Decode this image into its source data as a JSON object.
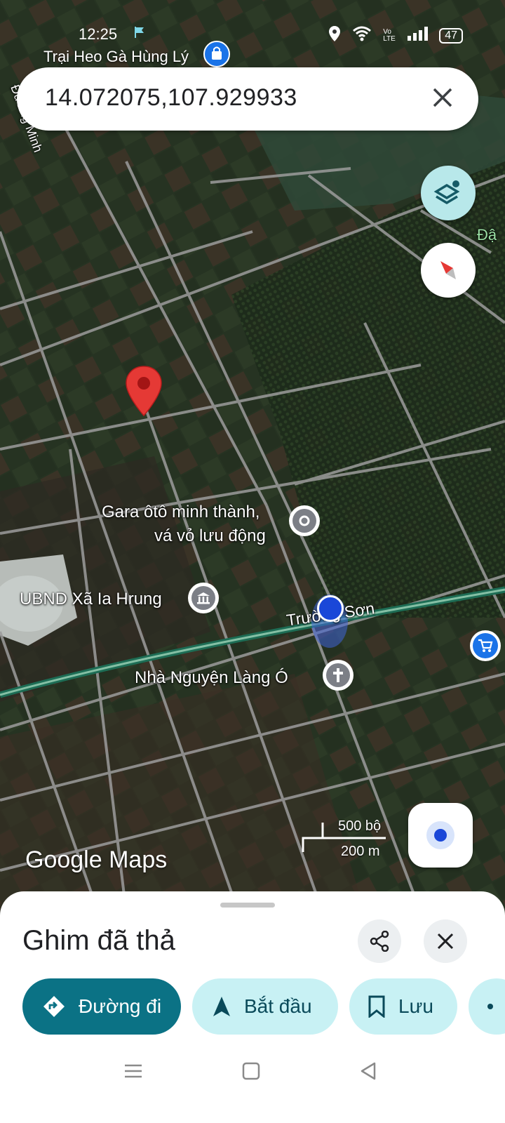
{
  "status_bar": {
    "time": "12:25",
    "battery": "47",
    "network": "Vo LTE"
  },
  "top_place_label": "Trại Heo Gà Hùng Lý",
  "search": {
    "value": "14.072075,107.929933"
  },
  "road_labels": {
    "left_road": "Đường Minh",
    "edge_label": "Đậ",
    "main_road": "Trường Sơn"
  },
  "places": [
    {
      "name_line1": "Gara ôtô minh thành,",
      "name_line2": "vá vỏ lưu động",
      "icon": "location-icon"
    },
    {
      "name": "UBND Xã Ia Hrung",
      "icon": "government-icon"
    },
    {
      "name": "Nhà Nguyện Làng Ó",
      "icon": "cross-icon"
    }
  ],
  "scale": {
    "imperial": "500 bộ",
    "metric": "200 m"
  },
  "brand": "Google Maps",
  "sheet": {
    "title": "Ghim đã thả",
    "actions": {
      "directions": "Đường đi",
      "start": "Bắt đầu",
      "save": "Lưu"
    }
  },
  "colors": {
    "accent": "#0b7285",
    "chip_secondary": "#c8f1f4",
    "pin": "#e53935",
    "my_location": "#1a47d8"
  }
}
